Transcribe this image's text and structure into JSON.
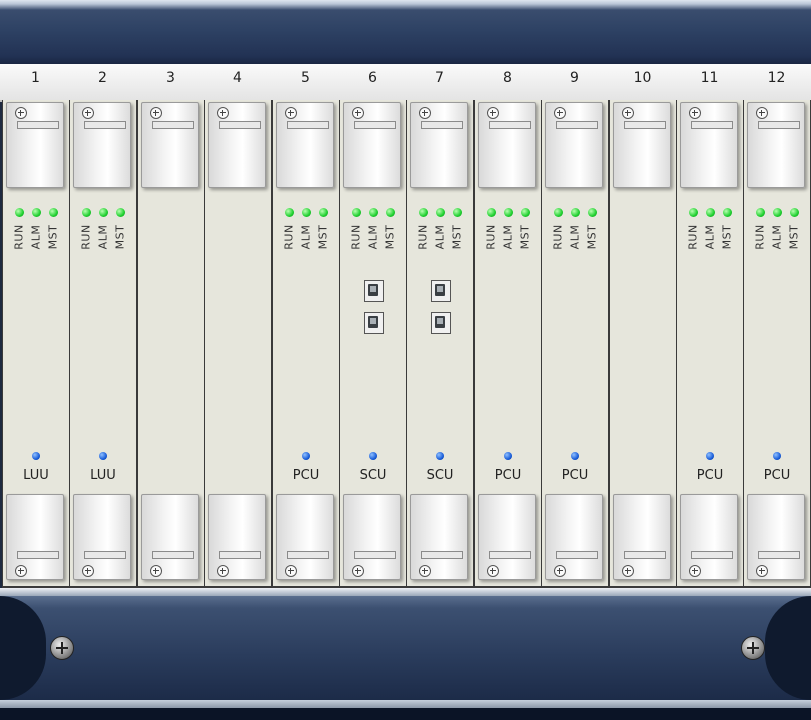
{
  "chassis": {
    "slots": [
      {
        "number": "1",
        "card": "LUU",
        "leds": [
          "RUN",
          "ALM",
          "MST"
        ],
        "ports": 0
      },
      {
        "number": "2",
        "card": "LUU",
        "leds": [
          "RUN",
          "ALM",
          "MST"
        ],
        "ports": 0
      },
      {
        "number": "3",
        "card": "",
        "leds": [],
        "ports": 0
      },
      {
        "number": "4",
        "card": "",
        "leds": [],
        "ports": 0
      },
      {
        "number": "5",
        "card": "PCU",
        "leds": [
          "RUN",
          "ALM",
          "MST"
        ],
        "ports": 0
      },
      {
        "number": "6",
        "card": "SCU",
        "leds": [
          "RUN",
          "ALM",
          "MST"
        ],
        "ports": 2
      },
      {
        "number": "7",
        "card": "SCU",
        "leds": [
          "RUN",
          "ALM",
          "MST"
        ],
        "ports": 2
      },
      {
        "number": "8",
        "card": "PCU",
        "leds": [
          "RUN",
          "ALM",
          "MST"
        ],
        "ports": 0
      },
      {
        "number": "9",
        "card": "PCU",
        "leds": [
          "RUN",
          "ALM",
          "MST"
        ],
        "ports": 0
      },
      {
        "number": "10",
        "card": "",
        "leds": [],
        "ports": 0
      },
      {
        "number": "11",
        "card": "PCU",
        "leds": [
          "RUN",
          "ALM",
          "MST"
        ],
        "ports": 0
      },
      {
        "number": "12",
        "card": "PCU",
        "leds": [
          "RUN",
          "ALM",
          "MST"
        ],
        "ports": 0
      }
    ]
  },
  "colors": {
    "status_led": "#20d030",
    "active_led": "#1257d6",
    "chassis_frame": "#223254",
    "slot_face": "#e6e6dc"
  }
}
